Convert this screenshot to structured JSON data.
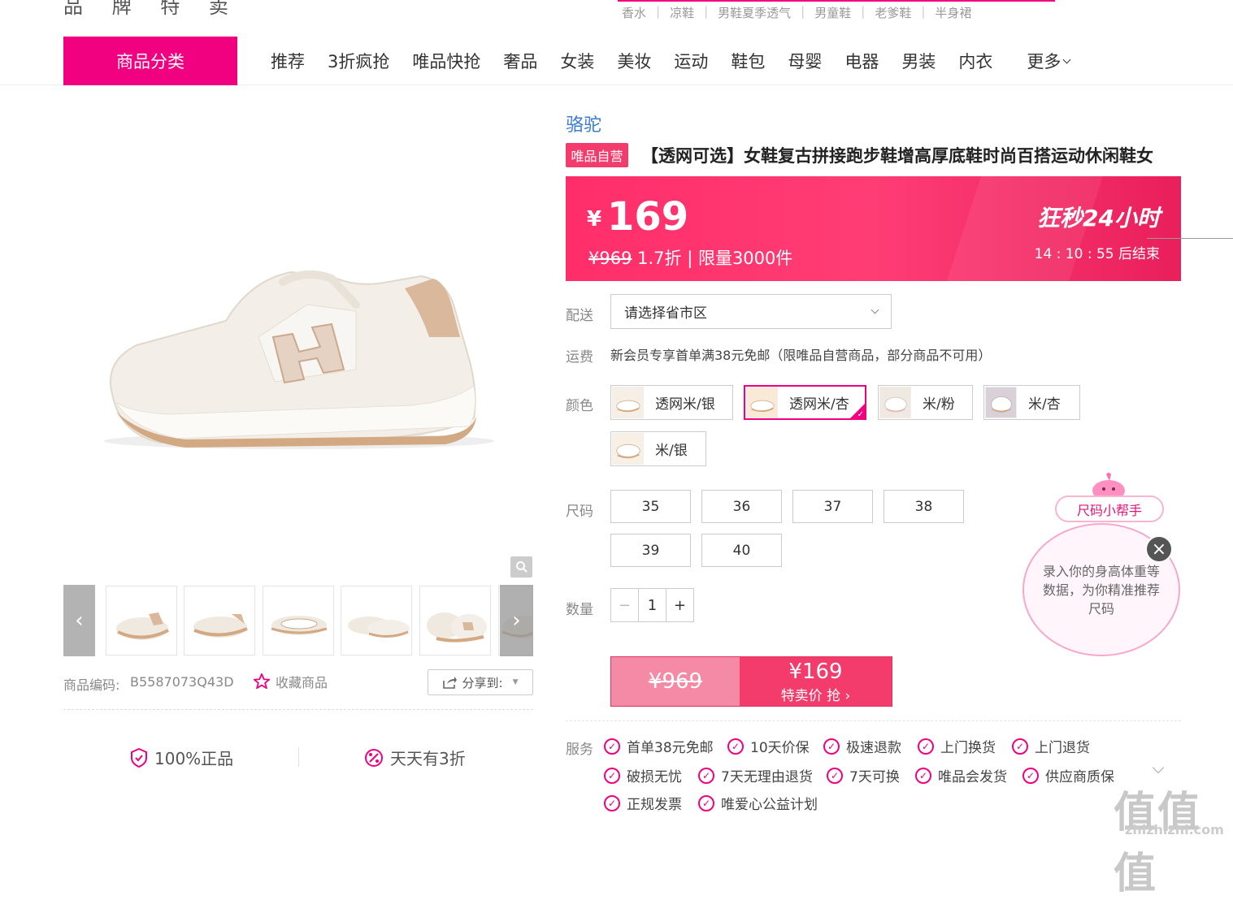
{
  "header": {
    "brand_remnant": "品 牌 特 卖",
    "hotwords": [
      "香水",
      "凉鞋",
      "男鞋夏季透气",
      "男童鞋",
      "老爹鞋",
      "半身裙"
    ]
  },
  "nav": {
    "category_button": "商品分类",
    "items": [
      "推荐",
      "3折疯抢",
      "唯品快抢",
      "奢品",
      "女装",
      "美妆",
      "运动",
      "鞋包",
      "母婴",
      "电器",
      "男装",
      "内衣"
    ],
    "more": "更多"
  },
  "gallery": {
    "product_code_label": "商品编码:",
    "product_code": "B5587073Q43D",
    "favorite": "收藏商品",
    "share": "分享到:",
    "guarantees": [
      "100%正品",
      "天天有3折"
    ]
  },
  "product": {
    "brand": "骆驼",
    "badge": "唯品自营",
    "title": "【透网可选】女鞋复古拼接跑步鞋增高厚底鞋时尚百搭运动休闲鞋女",
    "currency": "¥",
    "price": "169",
    "original_price": "¥969",
    "discount_text": " 1.7折 | 限量3000件",
    "flash_label": "狂秒24小时",
    "countdown": "14 : 10 : 55  后结束"
  },
  "delivery": {
    "label": "配送",
    "placeholder": "请选择省市区"
  },
  "shipping": {
    "label": "运费",
    "text": "新会员专享首单满38元免邮（限唯品自营商品，部分商品不可用）"
  },
  "colors": {
    "label": "颜色",
    "options": [
      "透网米/银",
      "透网米/杏",
      "米/粉",
      "米/杏",
      "米/银"
    ],
    "selected_index": 1
  },
  "sizes": {
    "label": "尺码",
    "options": [
      "35",
      "36",
      "37",
      "38",
      "39",
      "40"
    ]
  },
  "quantity": {
    "label": "数量",
    "value": "1",
    "minus": "−",
    "plus": "+"
  },
  "buy": {
    "original": "¥969",
    "price": "¥169",
    "action": "特卖价 抢 ›"
  },
  "services": {
    "label": "服务",
    "items": [
      "首单38元免邮",
      "10天价保",
      "极速退款",
      "上门换货",
      "上门退货",
      "破损无忧",
      "7天无理由退货",
      "7天可换",
      "唯品会发货",
      "供应商质保",
      "正规发票",
      "唯爱心公益计划"
    ]
  },
  "size_helper": {
    "button": "尺码小帮手",
    "bubble": "录入你的身高体重等数据，为你精准推荐尺码",
    "close": "×"
  },
  "watermark": {
    "text": "值值值",
    "sub": "zhizhizhi.com"
  },
  "colors_palette": {
    "accent": "#f10180",
    "price_red": "#f33c6b",
    "brand_blue": "#3a7bd5"
  }
}
